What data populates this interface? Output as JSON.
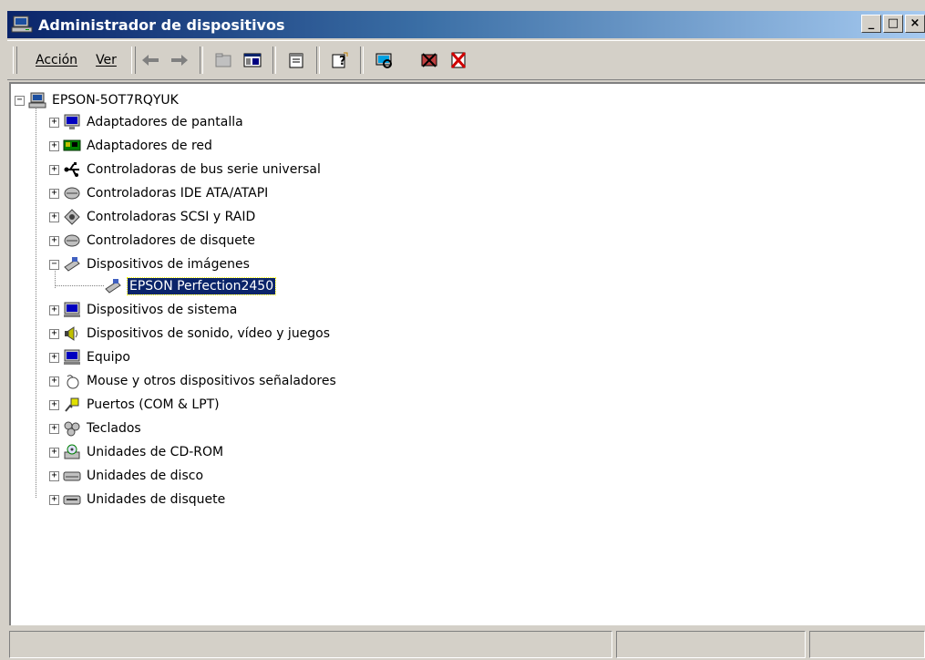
{
  "window": {
    "title": "Administrador de dispositivos",
    "minimize": "_",
    "maximize": "□",
    "close": "×"
  },
  "menu": {
    "items": [
      "Acción",
      "Ver"
    ]
  },
  "toolbar": {
    "icons": [
      "back-arrow-icon",
      "forward-arrow-icon",
      "up-folder-icon",
      "show-hide-tree-icon",
      "properties-icon",
      "help-icon",
      "scan-hardware-icon",
      "uninstall-icon",
      "disable-icon"
    ]
  },
  "tree": {
    "root": "EPSON-5OT7RQYUK",
    "categories": [
      {
        "label": "Adaptadores de pantalla",
        "icon": "monitor-icon",
        "expander": "+"
      },
      {
        "label": "Adaptadores de red",
        "icon": "network-card-icon",
        "expander": "+"
      },
      {
        "label": "Controladoras de bus serie universal",
        "icon": "usb-icon",
        "expander": "+"
      },
      {
        "label": "Controladoras IDE ATA/ATAPI",
        "icon": "ide-drive-icon",
        "expander": "+"
      },
      {
        "label": "Controladoras SCSI y RAID",
        "icon": "scsi-icon",
        "expander": "+"
      },
      {
        "label": "Controladores de disquete",
        "icon": "floppy-controller-icon",
        "expander": "+"
      },
      {
        "label": "Dispositivos de imágenes",
        "icon": "scanner-icon",
        "expander": "−"
      },
      {
        "label": "Dispositivos de sistema",
        "icon": "system-device-icon",
        "expander": "+"
      },
      {
        "label": "Dispositivos de sonido, vídeo y juegos",
        "icon": "speaker-icon",
        "expander": "+"
      },
      {
        "label": "Equipo",
        "icon": "computer-icon",
        "expander": "+"
      },
      {
        "label": "Mouse y otros dispositivos señaladores",
        "icon": "mouse-icon",
        "expander": "+"
      },
      {
        "label": "Puertos (COM & LPT)",
        "icon": "port-icon",
        "expander": "+"
      },
      {
        "label": "Teclados",
        "icon": "keyboard-icon",
        "expander": "+"
      },
      {
        "label": "Unidades de CD-ROM",
        "icon": "cdrom-icon",
        "expander": "+"
      },
      {
        "label": "Unidades de disco",
        "icon": "disk-drive-icon",
        "expander": "+"
      },
      {
        "label": "Unidades de disquete",
        "icon": "floppy-drive-icon",
        "expander": "+"
      }
    ],
    "child": {
      "label": "EPSON Perfection2450",
      "icon": "scanner-icon",
      "selected": true
    }
  },
  "colors": {
    "titlebar_start": "#0a246a",
    "titlebar_end": "#a6caf0",
    "selection": "#0a246a",
    "face": "#d4d0c8"
  }
}
